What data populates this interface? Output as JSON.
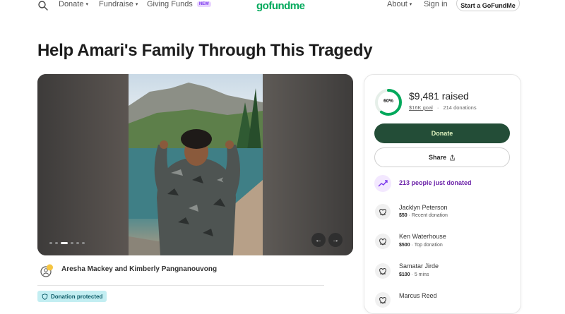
{
  "header": {
    "nav_left": [
      {
        "label": "Donate",
        "caret": true
      },
      {
        "label": "Fundraise",
        "caret": true
      },
      {
        "label": "Giving Funds",
        "caret": false,
        "badge": "NEW"
      }
    ],
    "logo_text": "gofundme",
    "nav_right": [
      {
        "label": "About",
        "caret": true
      },
      {
        "label": "Sign in",
        "caret": false
      }
    ],
    "start_button": "Start a GoFundMe"
  },
  "campaign": {
    "title": "Help Amari's Family Through This Tragedy",
    "organizer": "Aresha Mackey and Kimberly Pangnanouvong",
    "protected_label": "Donation protected",
    "carousel": {
      "slides": 6,
      "active_index": 2
    }
  },
  "donation_card": {
    "progress_percent": 60,
    "progress_label": "60%",
    "raised": "$9,481 raised",
    "goal": "$16K goal",
    "separator": "·",
    "donations_count": "214 donations",
    "donate_label": "Donate",
    "share_label": "Share",
    "trending_text": "213 people just donated",
    "donors": [
      {
        "name": "Jacklyn Peterson",
        "amount": "$50",
        "detail": "Recent donation"
      },
      {
        "name": "Ken Waterhouse",
        "amount": "$500",
        "detail": "Top donation"
      },
      {
        "name": "Samatar Jirde",
        "amount": "$100",
        "detail": "5 mins"
      },
      {
        "name": "Marcus Reed",
        "amount": "",
        "detail": ""
      }
    ]
  },
  "colors": {
    "brand_green": "#02a95c",
    "donate_bg": "#234d37",
    "donate_text": "#dff3c0",
    "trending_purple": "#6b21a8",
    "protected_bg": "#c3eef2"
  }
}
